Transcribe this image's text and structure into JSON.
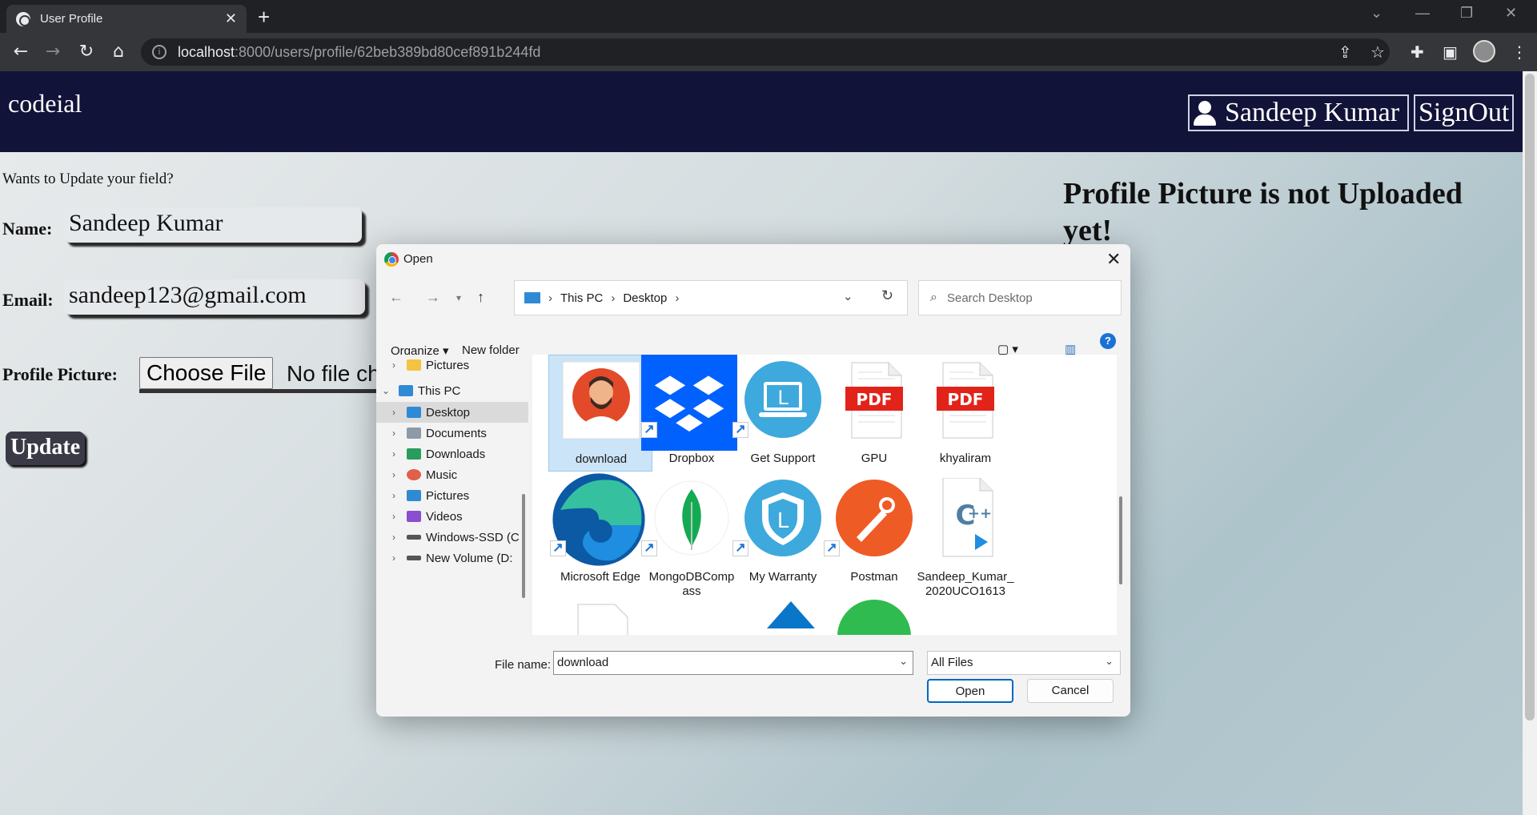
{
  "browser": {
    "tab_title": "User Profile",
    "url_host": "localhost",
    "url_path": ":8000/users/profile/62beb389bd80cef891b244fd"
  },
  "site": {
    "logo": "codeial",
    "user_name": "Sandeep Kumar",
    "signout_label": "SignOut"
  },
  "form": {
    "prompt": "Wants to Update your field?",
    "name_label": "Name:",
    "name_value": "Sandeep Kumar",
    "email_label": "Email:",
    "email_value": "sandeep123@gmail.com",
    "picture_label": "Profile Picture:",
    "choose_file_label": "Choose File",
    "no_file_text": "No file ch",
    "update_label": "Update"
  },
  "profile_notice": "Profile Picture is not Uploaded yet!",
  "dialog": {
    "title": "Open",
    "path": [
      "This PC",
      "Desktop"
    ],
    "search_placeholder": "Search Desktop",
    "organize_label": "Organize",
    "new_folder_label": "New folder",
    "help_label": "?",
    "tree": [
      {
        "label": "Pictures",
        "icon_color": "#f5c342"
      },
      {
        "label": "This PC",
        "icon_color": "#2f8ad4"
      },
      {
        "label": "Desktop",
        "icon_color": "#2f8ad4"
      },
      {
        "label": "Documents",
        "icon_color": "#8c9aa8"
      },
      {
        "label": "Downloads",
        "icon_color": "#2a9d5c"
      },
      {
        "label": "Music",
        "icon_color": "#e0604a"
      },
      {
        "label": "Pictures",
        "icon_color": "#2f8ad4"
      },
      {
        "label": "Videos",
        "icon_color": "#8a4fd0"
      },
      {
        "label": "Windows-SSD (C",
        "icon_color": "#555555"
      },
      {
        "label": "New Volume (D:",
        "icon_color": "#555555"
      }
    ],
    "files": [
      {
        "name": "download",
        "icon": "avatar-icon"
      },
      {
        "name": "Dropbox",
        "icon": "dropbox-icon"
      },
      {
        "name": "Get Support",
        "icon": "get-support-icon"
      },
      {
        "name": "GPU",
        "icon": "pdf-icon"
      },
      {
        "name": "khyaliram",
        "icon": "pdf-icon"
      },
      {
        "name": "Microsoft Edge",
        "icon": "edge-icon"
      },
      {
        "name": "MongoDBCompass",
        "icon": "mongodb-icon"
      },
      {
        "name": "My Warranty",
        "icon": "warranty-icon"
      },
      {
        "name": "Postman",
        "icon": "postman-icon"
      },
      {
        "name": "Sandeep_Kumar_2020UCO1613",
        "icon": "cpp-file-icon"
      }
    ],
    "pdf_badge": "PDF",
    "file_name_label": "File name:",
    "file_name_value": "download",
    "file_type": "All Files",
    "open_label": "Open",
    "cancel_label": "Cancel"
  },
  "colors": {
    "header_bg": "#121338",
    "dropbox": "#0061fe",
    "pdf_red": "#e2231a",
    "postman": "#ef5b25",
    "support_blue": "#3ea9dc"
  }
}
